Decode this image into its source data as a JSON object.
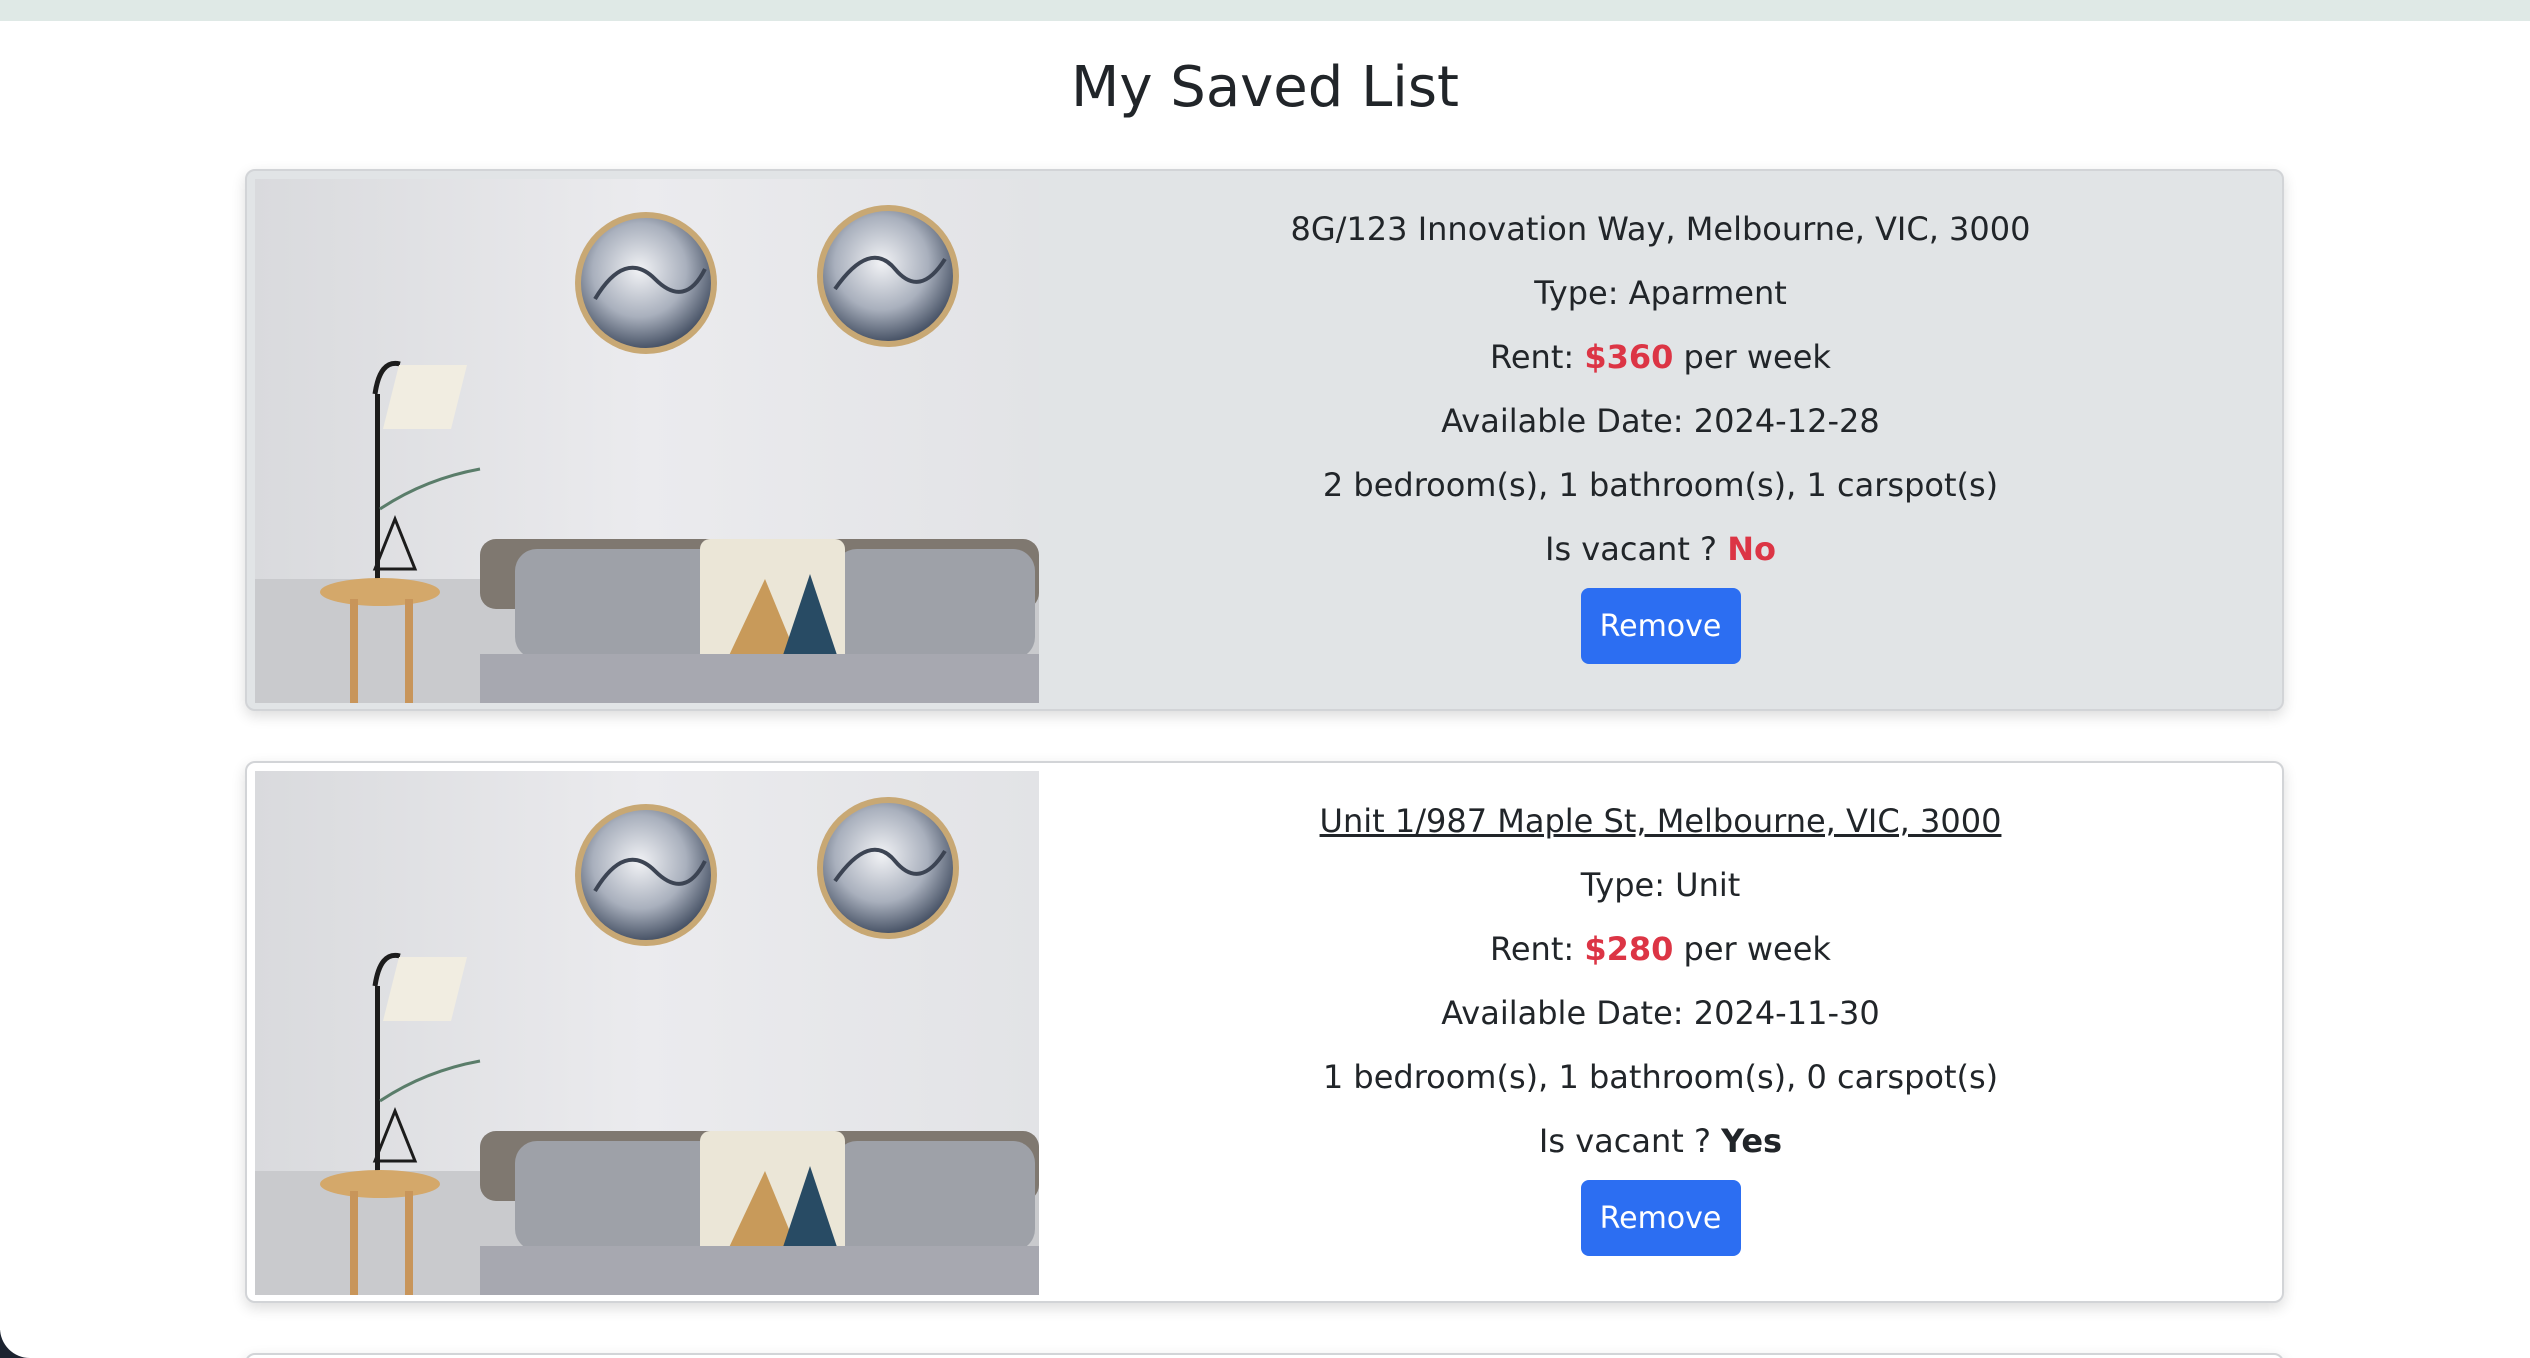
{
  "page": {
    "title": "My Saved List"
  },
  "theme": {
    "accent": "#2c6ef2",
    "price_color": "#dc3545",
    "highlight_card_bg": "#e1e4e6"
  },
  "listings": [
    {
      "address": "8G/123 Innovation Way, Melbourne, VIC, 3000",
      "type_label": "Type:",
      "type": "Aparment",
      "rent_label": "Rent:",
      "rent": "$360",
      "rent_suffix": "per week",
      "available_label": "Available Date:",
      "available_date": "2024-12-28",
      "rooms": "2 bedroom(s), 1 bathroom(s), 1 carspot(s)",
      "vacant_label": "Is vacant ?",
      "vacant": "No",
      "remove_label": "Remove",
      "photo_icon": "bedroom-photo"
    },
    {
      "address": "Unit 1/987 Maple St, Melbourne, VIC, 3000",
      "type_label": "Type:",
      "type": "Unit",
      "rent_label": "Rent:",
      "rent": "$280",
      "rent_suffix": "per week",
      "available_label": "Available Date:",
      "available_date": "2024-11-30",
      "rooms": "1 bedroom(s), 1 bathroom(s), 0 carspot(s)",
      "vacant_label": "Is vacant ?",
      "vacant": "Yes",
      "remove_label": "Remove",
      "photo_icon": "bedroom-photo"
    }
  ]
}
